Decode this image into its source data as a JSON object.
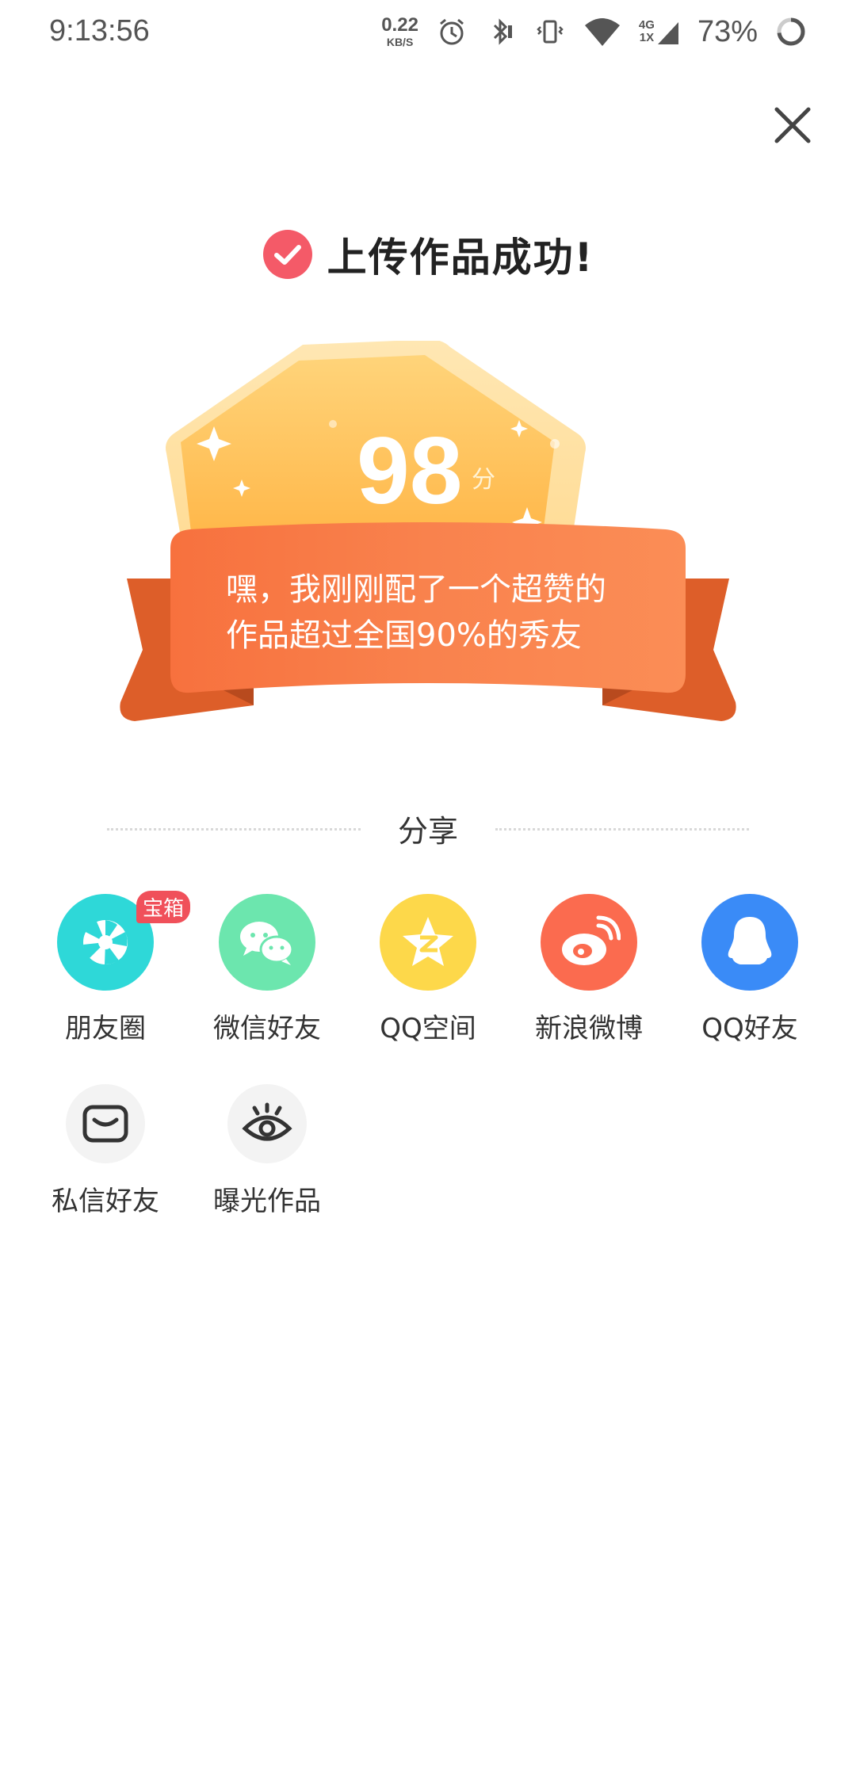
{
  "status_bar": {
    "time": "9:13:56",
    "net_speed": "0.22",
    "net_speed_unit": "KB/S",
    "network_type_top": "4G",
    "network_type_bottom": "1X",
    "battery": "73%"
  },
  "dialog": {
    "title": "上传作品成功!",
    "score": "98",
    "score_unit": "分",
    "ribbon_text_line1": "嘿，我刚刚配了一个超赞的",
    "ribbon_text_line2": "作品超过全国90%的秀友"
  },
  "share": {
    "heading": "分享",
    "items": [
      {
        "label": "朋友圈",
        "icon": "moments-icon",
        "color": "#2ed8d8",
        "tag": "宝箱"
      },
      {
        "label": "微信好友",
        "icon": "wechat-icon",
        "color": "#6ce6ae"
      },
      {
        "label": "QQ空间",
        "icon": "qzone-icon",
        "color": "#fdd84a"
      },
      {
        "label": "新浪微博",
        "icon": "weibo-icon",
        "color": "#fb6b4f"
      },
      {
        "label": "QQ好友",
        "icon": "qq-icon",
        "color": "#3a8bf7"
      }
    ],
    "extra_items": [
      {
        "label": "私信好友",
        "icon": "message-icon"
      },
      {
        "label": "曝光作品",
        "icon": "eye-icon"
      }
    ]
  }
}
